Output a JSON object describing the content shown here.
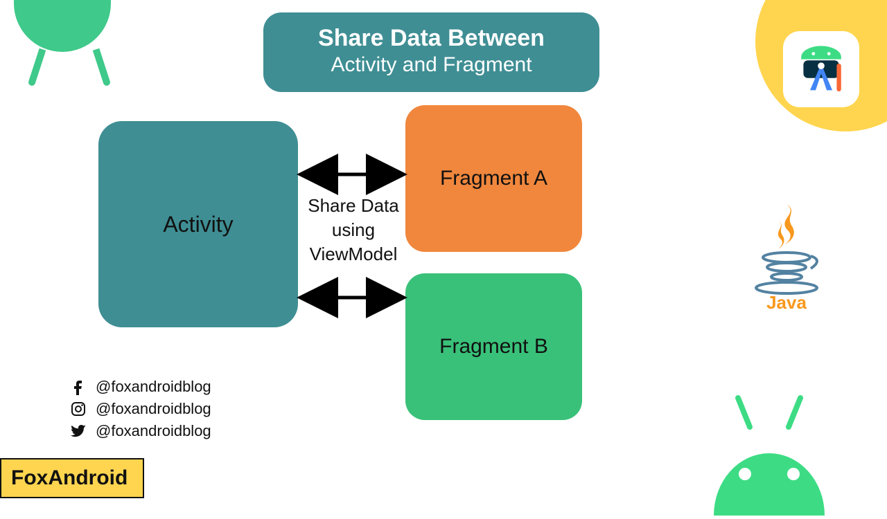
{
  "title": {
    "line1": "Share Data Between",
    "line2": "Activity and Fragment"
  },
  "boxes": {
    "activity": "Activity",
    "fragment_a": "Fragment A",
    "fragment_b": "Fragment B"
  },
  "center_label": {
    "line1": "Share Data",
    "line2": "using",
    "line3": "ViewModel"
  },
  "socials": {
    "facebook": "@foxandroidblog",
    "instagram": "@foxandroidblog",
    "twitter": "@foxandroidblog"
  },
  "footer_badge": "FoxAndroid",
  "java_label": "Java",
  "colors": {
    "teal": "#3f8e94",
    "orange": "#f0873d",
    "green": "#39c179",
    "yellow": "#ffd54f",
    "android_green": "#3fc98a"
  }
}
